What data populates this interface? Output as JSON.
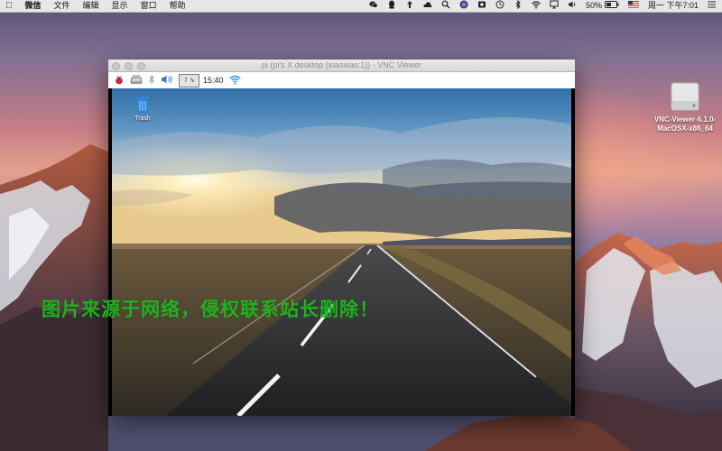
{
  "menubar": {
    "apple_icon": "apple-icon",
    "app_name": "微信",
    "menus": [
      "文件",
      "编辑",
      "显示",
      "窗口",
      "帮助"
    ],
    "battery": "50%",
    "clock": "周一 下午7:01"
  },
  "desktop_icon": {
    "label_line1": "VNC-Viewer-6.1.0-",
    "label_line2": "MacOSX-x86_64"
  },
  "window": {
    "title": "pi (pi's X desktop (xiaoxiao:1)) - VNC Viewer"
  },
  "pi_panel": {
    "cpu_usage": "7 %",
    "time": "15:40"
  },
  "remote_desktop": {
    "trash_label": "Trash"
  },
  "watermark": "图片来源于网络，侵权联系站长删除！"
}
